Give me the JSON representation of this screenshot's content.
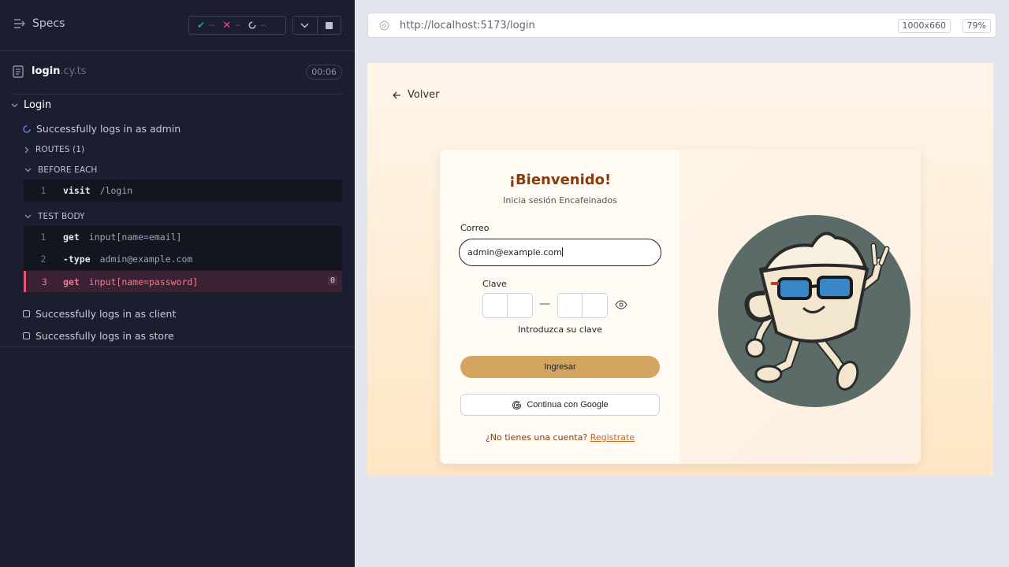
{
  "runner": {
    "specs_label": "Specs",
    "stats": {
      "passed": "--",
      "failed": "--",
      "pending": "--"
    },
    "file": {
      "name": "login",
      "ext": ".cy.ts",
      "duration": "00:06"
    },
    "suite": {
      "title": "Login"
    },
    "tests": [
      {
        "title": "Successfully logs in as admin",
        "state": "running"
      },
      {
        "title": "Successfully logs in as client",
        "state": "queued"
      },
      {
        "title": "Successfully logs in as store",
        "state": "queued"
      }
    ],
    "routes_label": "ROUTES (1)",
    "before_each_label": "BEFORE EACH",
    "test_body_label": "TEST BODY",
    "before_each_commands": [
      {
        "num": "1",
        "name": "visit",
        "arg": "/login"
      }
    ],
    "test_body_commands": [
      {
        "num": "1",
        "name": "get",
        "arg": "input[name=email]"
      },
      {
        "num": "2",
        "name": "-type",
        "arg": "admin@example.com"
      },
      {
        "num": "3",
        "name": "get",
        "arg": "input[name=password]",
        "badge": "0",
        "state": "failed"
      }
    ]
  },
  "browser": {
    "url": "http://localhost:5173/login",
    "viewport": "1000x660",
    "zoom": "79%"
  },
  "app": {
    "back_label": "Volver",
    "title": "¡Bienvenido!",
    "subtitle": "Inicia sesión Encafeinados",
    "email_label": "Correo",
    "email_value": "admin@example.com",
    "password_label": "Clave",
    "password_hint": "Introduzca su clave",
    "submit_label": "Ingresar",
    "google_label": "Continua con Google",
    "signup_prompt": "¿No tienes una cuenta?",
    "signup_link": "Registrate"
  },
  "colors": {
    "runner_bg": "#1b1e2e",
    "error": "#e45770",
    "brand_title": "#8a3a08",
    "button": "#d4a461",
    "mascot_circle": "#5b6b67"
  }
}
